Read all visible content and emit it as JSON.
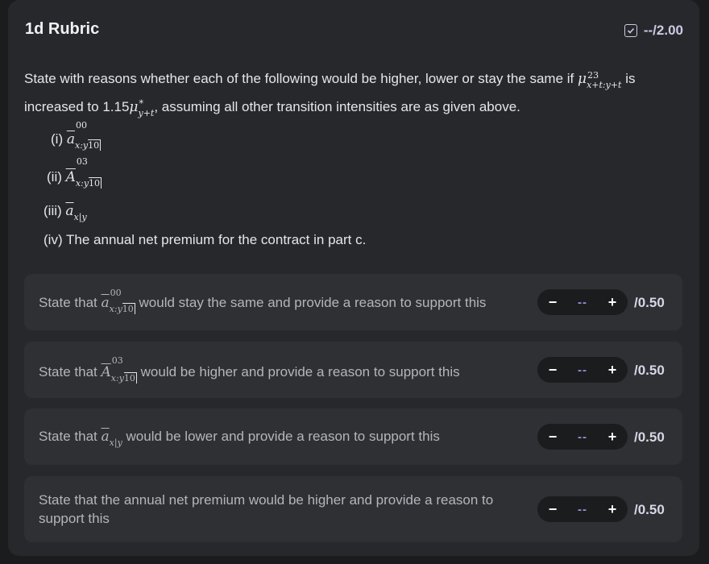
{
  "header": {
    "title": "1d Rubric",
    "score": "--/2.00"
  },
  "question": {
    "text_start": "State with reasons whether each of the following would be higher, lower or stay the same if",
    "text_mu": "μ",
    "text_mu_sup": "23",
    "text_mu_sub": "x+t:y+t",
    "text_is": "is",
    "text_mid": "increased to 1.15",
    "text_mu2": "μ",
    "text_mu2_sup": "*",
    "text_mu2_sub": "y+t",
    "text_end": ", assuming all other transition intensities are as given above."
  },
  "parts": [
    {
      "label": "(i)",
      "sym": "a",
      "sup": "00",
      "sub": "x:y",
      "dur": "10"
    },
    {
      "label": "(ii)",
      "sym": "A",
      "sup": "03",
      "sub": "x:y",
      "dur": "10"
    },
    {
      "label": "(iii)",
      "sym": "a",
      "sub": "x|y"
    },
    {
      "label": "(iv) The annual net premium for the contract in part c."
    }
  ],
  "criteria": [
    {
      "pre": "State that",
      "sym": "a",
      "sup": "00",
      "sub": "x:y",
      "dur": "10",
      "post": "would stay the same and provide a reason to support this",
      "value": "--",
      "max": "/0.50"
    },
    {
      "pre": "State that",
      "sym": "A",
      "sup": "03",
      "sub": "x:y",
      "dur": "10",
      "post": "would be higher and provide a reason to support this",
      "value": "--",
      "max": "/0.50"
    },
    {
      "pre": "State that",
      "sym": "a",
      "sub": "x|y",
      "post": "would be lower and provide a reason to support this",
      "value": "--",
      "max": "/0.50"
    },
    {
      "text": "State that the annual net premium would be higher and provide a reason to support this",
      "value": "--",
      "max": "/0.50"
    }
  ],
  "stepper": {
    "minus": "−",
    "plus": "+"
  },
  "colors": {
    "accent": "#8f95d6",
    "panel": "#27282b",
    "row": "#2f3034"
  }
}
